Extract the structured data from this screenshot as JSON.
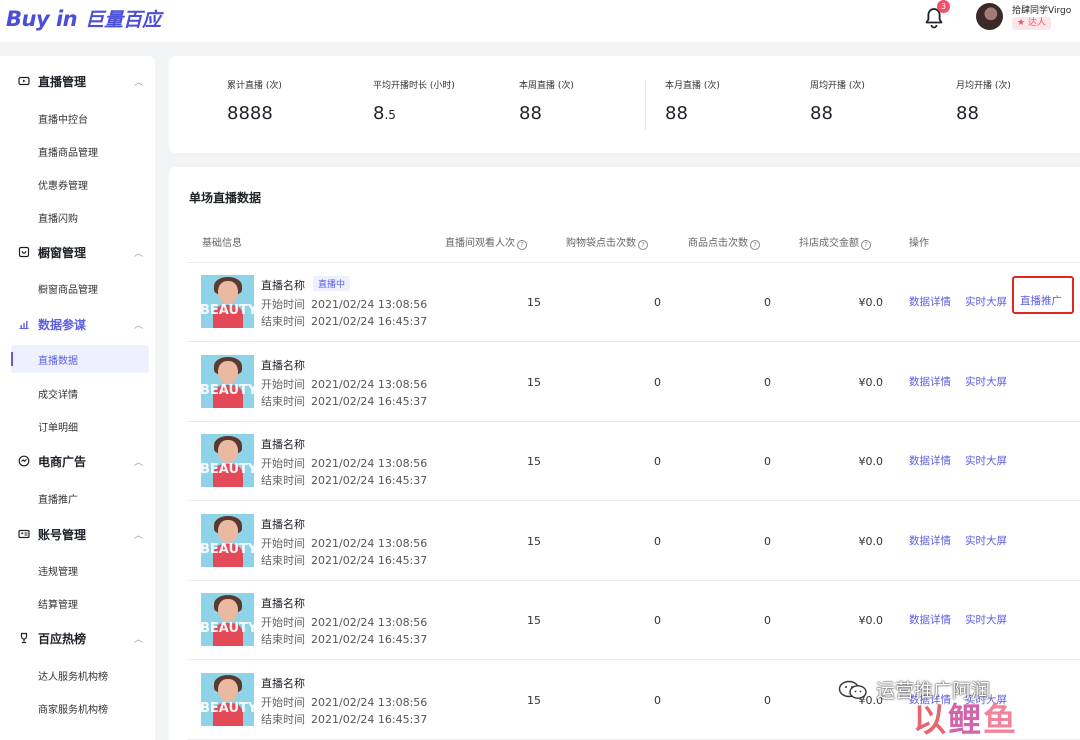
{
  "header": {
    "logo_en": "Buy in",
    "logo_cn": "巨量百应",
    "notification_count": "3",
    "user_name": "拾肆同学Virgo",
    "user_role": "达人"
  },
  "sidebar": {
    "groups": [
      {
        "label": "直播管理",
        "icon": "live-icon",
        "items": [
          "直播中控台",
          "直播商品管理",
          "优惠券管理",
          "直播闪购"
        ]
      },
      {
        "label": "橱窗管理",
        "icon": "window-icon",
        "items": [
          "橱窗商品管理"
        ]
      },
      {
        "label": "数据参谋",
        "icon": "chart-icon",
        "items": [
          "直播数据",
          "成交详情",
          "订单明细"
        ]
      },
      {
        "label": "电商广告",
        "icon": "ad-icon",
        "items": [
          "直播推广"
        ]
      },
      {
        "label": "账号管理",
        "icon": "account-icon",
        "items": [
          "违规管理",
          "结算管理"
        ]
      },
      {
        "label": "百应热榜",
        "icon": "trophy-icon",
        "items": [
          "达人服务机构榜",
          "商家服务机构榜"
        ]
      }
    ],
    "active_group": "数据参谋",
    "active_item": "直播数据"
  },
  "stats": [
    {
      "label": "累计直播 (次)",
      "value": "8888"
    },
    {
      "label": "平均开播时长 (小时)",
      "value_main": "8",
      "value_small": ".5"
    },
    {
      "label": "本周直播 (次)",
      "value": "88"
    },
    {
      "label": "本月直播 (次)",
      "value": "88"
    },
    {
      "label": "周均开播 (次)",
      "value": "88"
    },
    {
      "label": "月均开播 (次)",
      "value": "88"
    }
  ],
  "table": {
    "title": "单场直播数据",
    "columns": [
      "基础信息",
      "直播间观看人次",
      "购物袋点击次数",
      "商品点击次数",
      "抖店成交金额",
      "操作"
    ],
    "thumb_text": "BEAUTY",
    "name_label": "直播名称",
    "live_badge": "直播中",
    "start_label": "开始时间",
    "end_label": "结束时间",
    "actions": {
      "detail": "数据详情",
      "screen": "实时大屏",
      "promote": "直播推广"
    },
    "rows": [
      {
        "start": "2021/02/24 13:08:56",
        "end": "2021/02/24 16:45:37",
        "views": "15",
        "bag_clicks": "0",
        "product_clicks": "0",
        "gmv": "¥0.0"
      },
      {
        "start": "2021/02/24 13:08:56",
        "end": "2021/02/24 16:45:37",
        "views": "15",
        "bag_clicks": "0",
        "product_clicks": "0",
        "gmv": "¥0.0"
      },
      {
        "start": "2021/02/24 13:08:56",
        "end": "2021/02/24 16:45:37",
        "views": "15",
        "bag_clicks": "0",
        "product_clicks": "0",
        "gmv": "¥0.0"
      },
      {
        "start": "2021/02/24 13:08:56",
        "end": "2021/02/24 16:45:37",
        "views": "15",
        "bag_clicks": "0",
        "product_clicks": "0",
        "gmv": "¥0.0"
      },
      {
        "start": "2021/02/24 13:08:56",
        "end": "2021/02/24 16:45:37",
        "views": "15",
        "bag_clicks": "0",
        "product_clicks": "0",
        "gmv": "¥0.0"
      },
      {
        "start": "2021/02/24 13:08:56",
        "end": "2021/02/24 16:45:37",
        "views": "15",
        "bag_clicks": "0",
        "product_clicks": "0",
        "gmv": "¥0.0"
      }
    ]
  },
  "watermark": {
    "line1": "运营推广阿润",
    "line2a": "以",
    "line2b": "鲤",
    "line2c": "鱼"
  },
  "colors": {
    "accent": "#5b5fe0",
    "highlight_border": "#e0271f",
    "badge": "#f0506e"
  }
}
